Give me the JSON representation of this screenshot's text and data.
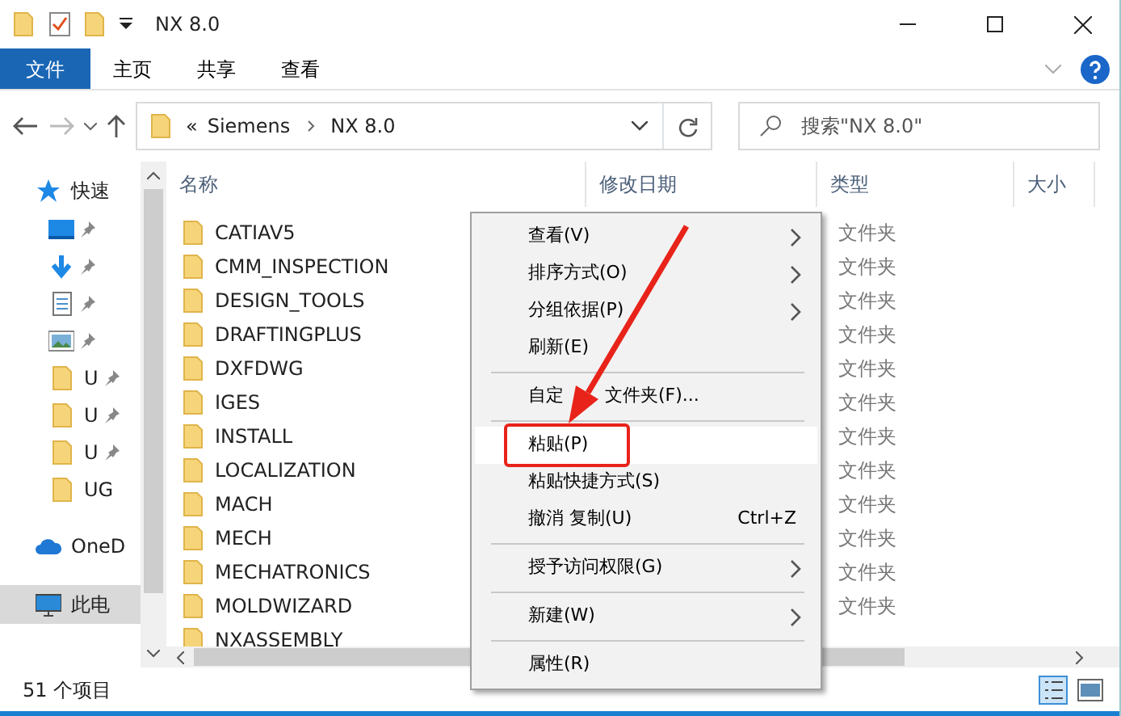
{
  "window": {
    "title": "NX 8.0"
  },
  "ribbon_tabs": [
    {
      "label": "文件",
      "kind": "file",
      "selected": false
    },
    {
      "label": "主页",
      "kind": "tab",
      "selected": false
    },
    {
      "label": "共享",
      "kind": "tab",
      "selected": false
    },
    {
      "label": "查看",
      "kind": "tab",
      "selected": false
    }
  ],
  "address_bar": {
    "prefix": "«",
    "path": [
      "Siemens",
      "NX 8.0"
    ]
  },
  "search": {
    "placeholder": "搜索\"NX 8.0\""
  },
  "sidebar": {
    "items": [
      {
        "kind": "star",
        "label": "快速",
        "pinned": false,
        "selected": false
      },
      {
        "kind": "desktop",
        "pinned": true,
        "selected": false
      },
      {
        "kind": "download",
        "pinned": true,
        "selected": false
      },
      {
        "kind": "document",
        "pinned": true,
        "selected": false
      },
      {
        "kind": "image",
        "pinned": true,
        "selected": false
      },
      {
        "kind": "folder",
        "label": "U",
        "pinned": true,
        "selected": false
      },
      {
        "kind": "folder",
        "label": "U",
        "pinned": true,
        "selected": false
      },
      {
        "kind": "folder",
        "label": "U",
        "pinned": true,
        "selected": false
      },
      {
        "kind": "folder",
        "label": "UG",
        "pinned": false,
        "selected": false
      },
      {
        "kind": "cloud",
        "label": "OneD",
        "pinned": false,
        "selected": false
      },
      {
        "kind": "computer",
        "label": "此电",
        "pinned": false,
        "selected": true
      }
    ]
  },
  "table": {
    "columns": [
      "名称",
      "修改日期",
      "类型",
      "大小"
    ],
    "rows": [
      {
        "name": "CATIAV5",
        "type": "文件夹"
      },
      {
        "name": "CMM_INSPECTION",
        "type": "文件夹"
      },
      {
        "name": "DESIGN_TOOLS",
        "type": "文件夹"
      },
      {
        "name": "DRAFTINGPLUS",
        "type": "文件夹"
      },
      {
        "name": "DXFDWG",
        "type": "文件夹"
      },
      {
        "name": "IGES",
        "type": "文件夹"
      },
      {
        "name": "INSTALL",
        "type": "文件夹"
      },
      {
        "name": "LOCALIZATION",
        "type": "文件夹"
      },
      {
        "name": "MACH",
        "type": "文件夹"
      },
      {
        "name": "MECH",
        "type": "文件夹"
      },
      {
        "name": "MECHATRONICS",
        "type": "文件夹"
      },
      {
        "name": "MOLDWIZARD",
        "type": "文件夹"
      },
      {
        "name": "NXASSEMBLY"
      }
    ]
  },
  "context_menu": {
    "items": [
      {
        "kind": "item",
        "label": "查看(V)",
        "submenu": true,
        "selected": false
      },
      {
        "kind": "item",
        "label": "排序方式(O)",
        "submenu": true,
        "selected": false
      },
      {
        "kind": "item",
        "label": "分组依据(P)",
        "submenu": true,
        "selected": false
      },
      {
        "kind": "item",
        "label": "刷新(E)",
        "submenu": false,
        "selected": false
      },
      {
        "kind": "separator"
      },
      {
        "kind": "item",
        "label": "自定 文件夹(F)...",
        "submenu": false,
        "selected": false,
        "covered_by_arrow": true
      },
      {
        "kind": "separator"
      },
      {
        "kind": "item",
        "label": "粘贴(P)",
        "submenu": false,
        "selected": true,
        "annotated": true
      },
      {
        "kind": "item",
        "label": "粘贴快捷方式(S)",
        "submenu": false,
        "selected": false
      },
      {
        "kind": "item",
        "label": "撤消 复制(U)",
        "shortcut": "Ctrl+Z",
        "submenu": false,
        "selected": false
      },
      {
        "kind": "separator"
      },
      {
        "kind": "item",
        "label": "授予访问权限(G)",
        "submenu": true,
        "selected": false
      },
      {
        "kind": "separator"
      },
      {
        "kind": "item",
        "label": "新建(W)",
        "submenu": true,
        "selected": false
      },
      {
        "kind": "separator"
      },
      {
        "kind": "item",
        "label": "属性(R)",
        "submenu": false,
        "selected": false
      }
    ]
  },
  "status_bar": {
    "count": "51 个项目"
  }
}
